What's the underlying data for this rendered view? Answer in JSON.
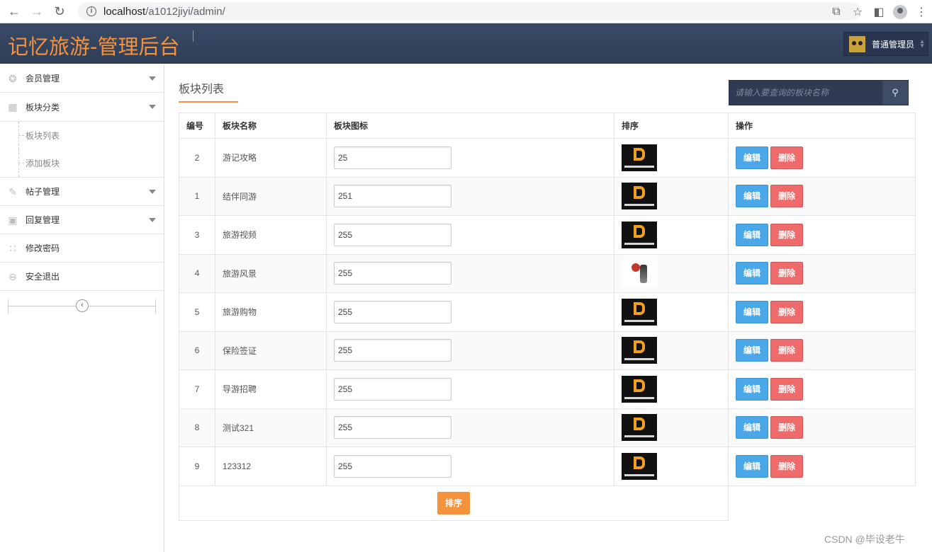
{
  "browser": {
    "url_host": "localhost",
    "url_path": "/a1012jiyi/admin/"
  },
  "header": {
    "brand": "记忆旅游-管理后台",
    "user": "普通管理员"
  },
  "sidebar": {
    "items": [
      {
        "label": "会员管理",
        "icon": "lifebuoy-icon",
        "caret": true
      },
      {
        "label": "板块分类",
        "icon": "calendar-icon",
        "caret": true
      },
      {
        "label": "帖子管理",
        "icon": "pencil-icon",
        "caret": true
      },
      {
        "label": "回复管理",
        "icon": "dashboard-icon",
        "caret": true
      },
      {
        "label": "修改密码",
        "icon": "grid-icon",
        "caret": false
      },
      {
        "label": "安全退出",
        "icon": "minus-circle-icon",
        "caret": false
      }
    ],
    "sub_items": [
      "板块列表",
      "添加板块"
    ]
  },
  "main": {
    "title": "板块列表",
    "search_placeholder": "请输入要查询的板块名称",
    "columns": [
      "编号",
      "板块名称",
      "板块图标",
      "排序",
      "操作"
    ],
    "rows": [
      {
        "id": "2",
        "name": "游记攻略",
        "sort": "25",
        "logo": "brand"
      },
      {
        "id": "1",
        "name": "结伴同游",
        "sort": "251",
        "logo": "brand"
      },
      {
        "id": "3",
        "name": "旅游视频",
        "sort": "255",
        "logo": "brand"
      },
      {
        "id": "4",
        "name": "旅游风景",
        "sort": "255",
        "logo": "calligraphy"
      },
      {
        "id": "5",
        "name": "旅游购物",
        "sort": "255",
        "logo": "brand"
      },
      {
        "id": "6",
        "name": "保险签证",
        "sort": "255",
        "logo": "brand"
      },
      {
        "id": "7",
        "name": "导游招聘",
        "sort": "255",
        "logo": "brand"
      },
      {
        "id": "8",
        "name": "测试321",
        "sort": "255",
        "logo": "brand"
      },
      {
        "id": "9",
        "name": "123312",
        "sort": "255",
        "logo": "brand"
      }
    ],
    "edit_label": "编辑",
    "delete_label": "删除",
    "sort_button": "排序"
  },
  "watermark": "CSDN @毕设老牛",
  "colors": {
    "accent": "#f5923e",
    "header": "#34435e",
    "edit": "#4aa8e8",
    "delete": "#ef6b6b"
  }
}
